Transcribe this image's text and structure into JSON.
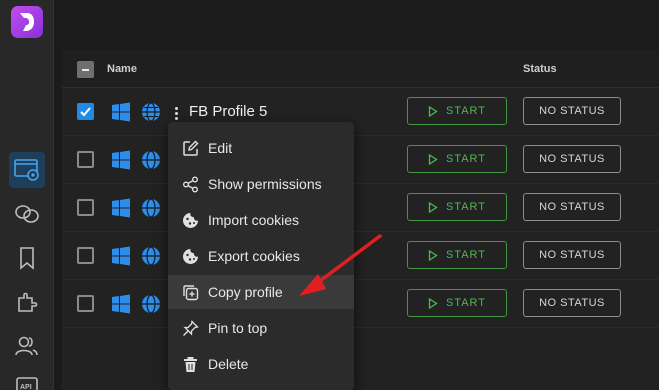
{
  "table": {
    "headers": {
      "name": "Name",
      "status": "Status"
    },
    "profile_name": "FB Profile 5",
    "start_label": "START",
    "status_label": "NO STATUS"
  },
  "menu": {
    "items": [
      {
        "label": "Edit",
        "icon": "edit-icon"
      },
      {
        "label": "Show permissions",
        "icon": "share-icon"
      },
      {
        "label": "Import cookies",
        "icon": "cookie-icon"
      },
      {
        "label": "Export cookies",
        "icon": "cookie-icon"
      },
      {
        "label": "Copy profile",
        "icon": "copy-icon"
      },
      {
        "label": "Pin to top",
        "icon": "pin-icon"
      },
      {
        "label": "Delete",
        "icon": "trash-icon"
      }
    ]
  },
  "sidebar": {
    "items": [
      "profiles-icon",
      "proxy-icon",
      "bookmark-icon",
      "extensions-icon",
      "users-icon",
      "api-icon"
    ]
  },
  "colors": {
    "accent": "#1e8ce6",
    "start_green": "#4fb84f",
    "annotation_red": "#e02020",
    "logo_purple": "#a63ee6"
  }
}
